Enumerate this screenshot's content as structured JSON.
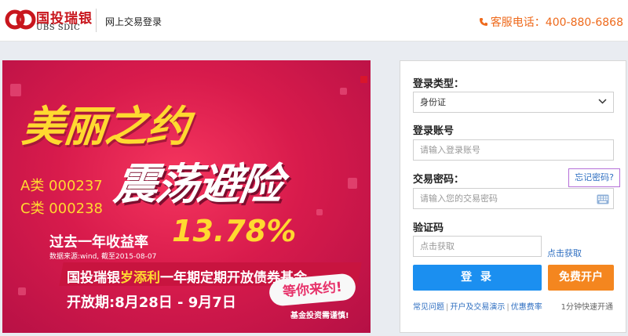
{
  "header": {
    "logo_cn": "国投瑞银",
    "logo_en": "UBS SDIC",
    "title": "网上交易登录",
    "hotline": "客服电话：400-880-6868"
  },
  "banner": {
    "title1": "美丽之约",
    "title2": "震荡避险",
    "code_a": "A类 000237",
    "code_c": "C类 000238",
    "return_label": "过去一年收益率",
    "return_value": "13.78%",
    "source": "数据来源:wind, 截至2015-08-07",
    "fund_prefix": "国投瑞银",
    "fund_highlight": "岁添利",
    "fund_suffix": "一年期定期开放债券基金",
    "wait": "等你来约!",
    "open_period": "开放期:8月28日 - 9月7日",
    "risk": "基金投资需谨慎!"
  },
  "login": {
    "type_label": "登录类型：",
    "type_value": "身份证",
    "account_label": "登录账号",
    "account_placeholder": "请输入登录账号",
    "password_label": "交易密码：",
    "password_placeholder": "请输入您的交易密码",
    "forgot": "忘记密码?",
    "captcha_label": "验证码",
    "captcha_placeholder": "点击获取",
    "get_code": "点击获取",
    "login_button": "登 录",
    "open_button": "免费开户",
    "link_faq": "常见问题",
    "link_demo": "开户及交易演示",
    "link_rates": "优惠费率",
    "quick": "1分钟快速开通"
  },
  "colors": {
    "brand_red": "#c8161d",
    "hotline": "#ee6a1c",
    "login_blue": "#1b8ff0",
    "open_orange": "#f4861f",
    "link_blue": "#2f6fc1"
  }
}
